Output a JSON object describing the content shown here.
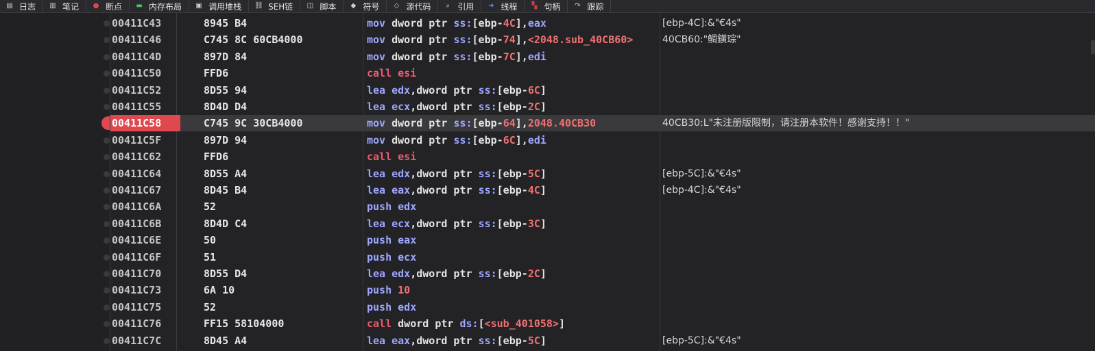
{
  "tabs": [
    {
      "label": "日志",
      "icon": "log-icon"
    },
    {
      "label": "笔记",
      "icon": "notes-icon"
    },
    {
      "label": "断点",
      "icon": "breakpoint-icon"
    },
    {
      "label": "内存布局",
      "icon": "memory-map-icon"
    },
    {
      "label": "调用堆栈",
      "icon": "call-stack-icon"
    },
    {
      "label": "SEH链",
      "icon": "seh-icon"
    },
    {
      "label": "脚本",
      "icon": "script-icon"
    },
    {
      "label": "符号",
      "icon": "symbols-icon"
    },
    {
      "label": "源代码",
      "icon": "source-icon"
    },
    {
      "label": "引用",
      "icon": "references-icon"
    },
    {
      "label": "线程",
      "icon": "threads-icon"
    },
    {
      "label": "句柄",
      "icon": "handles-icon"
    },
    {
      "label": "跟踪",
      "icon": "trace-icon"
    }
  ],
  "colors": {
    "background": "#232326",
    "mnemonic": "#9ea7ff",
    "call_mnemonic": "#f05a6e",
    "number": "#f07070",
    "selected_address_bg": "#e0484f"
  },
  "selected_row": 6,
  "rows": [
    {
      "addr": "00411C43",
      "bytes": "8945 B4",
      "instr": [
        [
          "mov",
          "mn-normal"
        ],
        [
          " dword ptr ",
          "op-text"
        ],
        [
          "ss:",
          "mn-normal"
        ],
        [
          "[ebp-",
          "op-text"
        ],
        [
          "4C",
          "op-num"
        ],
        [
          "],",
          "op-text"
        ],
        [
          "eax",
          "mn-normal"
        ]
      ],
      "comment": "[ebp-4C]:&\"€4s\""
    },
    {
      "addr": "00411C46",
      "bytes": "C745 8C 60CB4000",
      "instr": [
        [
          "mov",
          "mn-normal"
        ],
        [
          " dword ptr ",
          "op-text"
        ],
        [
          "ss:",
          "mn-normal"
        ],
        [
          "[ebp-",
          "op-text"
        ],
        [
          "74",
          "op-num"
        ],
        [
          "],",
          "op-text"
        ],
        [
          "<2048.sub_40CB60>",
          "op-num"
        ]
      ],
      "comment": "40CB60:\"鲷鐄琮\""
    },
    {
      "addr": "00411C4D",
      "bytes": "897D 84",
      "instr": [
        [
          "mov",
          "mn-normal"
        ],
        [
          " dword ptr ",
          "op-text"
        ],
        [
          "ss:",
          "mn-normal"
        ],
        [
          "[ebp-",
          "op-text"
        ],
        [
          "7C",
          "op-num"
        ],
        [
          "],",
          "op-text"
        ],
        [
          "edi",
          "mn-normal"
        ]
      ],
      "comment": ""
    },
    {
      "addr": "00411C50",
      "bytes": "FFD6",
      "instr": [
        [
          "call",
          "mn-call"
        ],
        [
          " ",
          "op-text"
        ],
        [
          "esi",
          "mn-call"
        ]
      ],
      "comment": ""
    },
    {
      "addr": "00411C52",
      "bytes": "8D55 94",
      "instr": [
        [
          "lea",
          "mn-normal"
        ],
        [
          " ",
          "op-text"
        ],
        [
          "edx",
          "mn-normal"
        ],
        [
          ",dword ptr ",
          "op-text"
        ],
        [
          "ss:",
          "mn-normal"
        ],
        [
          "[ebp-",
          "op-text"
        ],
        [
          "6C",
          "op-num"
        ],
        [
          "]",
          "op-text"
        ]
      ],
      "comment": ""
    },
    {
      "addr": "00411C55",
      "bytes": "8D4D D4",
      "instr": [
        [
          "lea",
          "mn-normal"
        ],
        [
          " ",
          "op-text"
        ],
        [
          "ecx",
          "mn-normal"
        ],
        [
          ",dword ptr ",
          "op-text"
        ],
        [
          "ss:",
          "mn-normal"
        ],
        [
          "[ebp-",
          "op-text"
        ],
        [
          "2C",
          "op-num"
        ],
        [
          "]",
          "op-text"
        ]
      ],
      "comment": ""
    },
    {
      "addr": "00411C58",
      "bytes": "C745 9C 30CB4000",
      "instr": [
        [
          "mov",
          "mn-normal"
        ],
        [
          " dword ptr ",
          "op-text"
        ],
        [
          "ss:",
          "mn-normal"
        ],
        [
          "[ebp-",
          "op-text"
        ],
        [
          "64",
          "op-num"
        ],
        [
          "],",
          "op-text"
        ],
        [
          "2048.40CB30",
          "op-num"
        ]
      ],
      "comment": "40CB30:L\"未注册版限制，请注册本软件！感谢支持！！\""
    },
    {
      "addr": "00411C5F",
      "bytes": "897D 94",
      "instr": [
        [
          "mov",
          "mn-normal"
        ],
        [
          " dword ptr ",
          "op-text"
        ],
        [
          "ss:",
          "mn-normal"
        ],
        [
          "[ebp-",
          "op-text"
        ],
        [
          "6C",
          "op-num"
        ],
        [
          "],",
          "op-text"
        ],
        [
          "edi",
          "mn-normal"
        ]
      ],
      "comment": ""
    },
    {
      "addr": "00411C62",
      "bytes": "FFD6",
      "instr": [
        [
          "call",
          "mn-call"
        ],
        [
          " ",
          "op-text"
        ],
        [
          "esi",
          "mn-call"
        ]
      ],
      "comment": ""
    },
    {
      "addr": "00411C64",
      "bytes": "8D55 A4",
      "instr": [
        [
          "lea",
          "mn-normal"
        ],
        [
          " ",
          "op-text"
        ],
        [
          "edx",
          "mn-normal"
        ],
        [
          ",dword ptr ",
          "op-text"
        ],
        [
          "ss:",
          "mn-normal"
        ],
        [
          "[ebp-",
          "op-text"
        ],
        [
          "5C",
          "op-num"
        ],
        [
          "]",
          "op-text"
        ]
      ],
      "comment": "[ebp-5C]:&\"€4s\""
    },
    {
      "addr": "00411C67",
      "bytes": "8D45 B4",
      "instr": [
        [
          "lea",
          "mn-normal"
        ],
        [
          " ",
          "op-text"
        ],
        [
          "eax",
          "mn-normal"
        ],
        [
          ",dword ptr ",
          "op-text"
        ],
        [
          "ss:",
          "mn-normal"
        ],
        [
          "[ebp-",
          "op-text"
        ],
        [
          "4C",
          "op-num"
        ],
        [
          "]",
          "op-text"
        ]
      ],
      "comment": "[ebp-4C]:&\"€4s\""
    },
    {
      "addr": "00411C6A",
      "bytes": "52",
      "instr": [
        [
          "push",
          "mn-normal"
        ],
        [
          " ",
          "op-text"
        ],
        [
          "edx",
          "mn-normal"
        ]
      ],
      "comment": ""
    },
    {
      "addr": "00411C6B",
      "bytes": "8D4D C4",
      "instr": [
        [
          "lea",
          "mn-normal"
        ],
        [
          " ",
          "op-text"
        ],
        [
          "ecx",
          "mn-normal"
        ],
        [
          ",dword ptr ",
          "op-text"
        ],
        [
          "ss:",
          "mn-normal"
        ],
        [
          "[ebp-",
          "op-text"
        ],
        [
          "3C",
          "op-num"
        ],
        [
          "]",
          "op-text"
        ]
      ],
      "comment": ""
    },
    {
      "addr": "00411C6E",
      "bytes": "50",
      "instr": [
        [
          "push",
          "mn-normal"
        ],
        [
          " ",
          "op-text"
        ],
        [
          "eax",
          "mn-normal"
        ]
      ],
      "comment": ""
    },
    {
      "addr": "00411C6F",
      "bytes": "51",
      "instr": [
        [
          "push",
          "mn-normal"
        ],
        [
          " ",
          "op-text"
        ],
        [
          "ecx",
          "mn-normal"
        ]
      ],
      "comment": ""
    },
    {
      "addr": "00411C70",
      "bytes": "8D55 D4",
      "instr": [
        [
          "lea",
          "mn-normal"
        ],
        [
          " ",
          "op-text"
        ],
        [
          "edx",
          "mn-normal"
        ],
        [
          ",dword ptr ",
          "op-text"
        ],
        [
          "ss:",
          "mn-normal"
        ],
        [
          "[ebp-",
          "op-text"
        ],
        [
          "2C",
          "op-num"
        ],
        [
          "]",
          "op-text"
        ]
      ],
      "comment": ""
    },
    {
      "addr": "00411C73",
      "bytes": "6A 10",
      "instr": [
        [
          "push",
          "mn-normal"
        ],
        [
          " ",
          "op-text"
        ],
        [
          "10",
          "op-num"
        ]
      ],
      "comment": ""
    },
    {
      "addr": "00411C75",
      "bytes": "52",
      "instr": [
        [
          "push",
          "mn-normal"
        ],
        [
          " ",
          "op-text"
        ],
        [
          "edx",
          "mn-normal"
        ]
      ],
      "comment": ""
    },
    {
      "addr": "00411C76",
      "bytes": "FF15 58104000",
      "instr": [
        [
          "call",
          "mn-call"
        ],
        [
          " dword ptr ",
          "op-text"
        ],
        [
          "ds:",
          "mn-normal"
        ],
        [
          "[",
          "op-text"
        ],
        [
          "<sub_401058>",
          "op-num"
        ],
        [
          "]",
          "op-text"
        ]
      ],
      "comment": ""
    },
    {
      "addr": "00411C7C",
      "bytes": "8D45 A4",
      "instr": [
        [
          "lea",
          "mn-normal"
        ],
        [
          " ",
          "op-text"
        ],
        [
          "eax",
          "mn-normal"
        ],
        [
          ",dword ptr ",
          "op-text"
        ],
        [
          "ss:",
          "mn-normal"
        ],
        [
          "[ebp-",
          "op-text"
        ],
        [
          "5C",
          "op-num"
        ],
        [
          "]",
          "op-text"
        ]
      ],
      "comment": "[ebp-5C]:&\"€4s\""
    }
  ]
}
